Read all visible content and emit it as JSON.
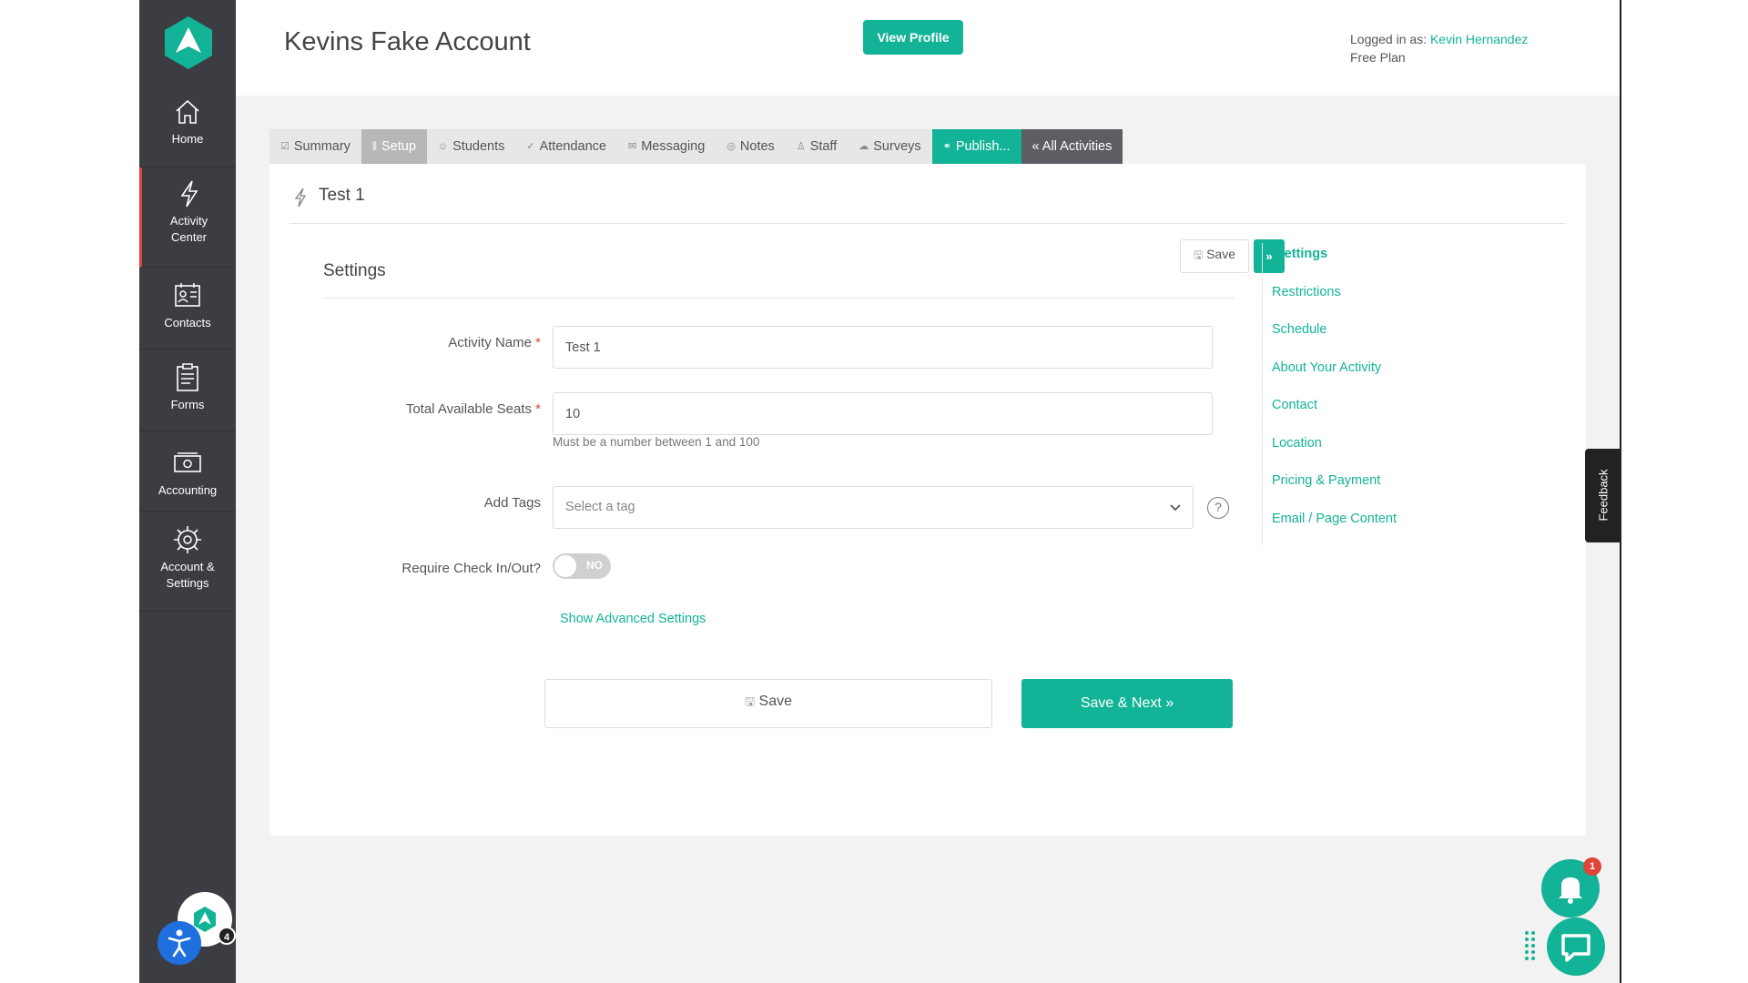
{
  "sidebar": {
    "items": [
      {
        "label": "Home"
      },
      {
        "label": "Activity Center"
      },
      {
        "label": "Contacts"
      },
      {
        "label": "Forms"
      },
      {
        "label": "Accounting"
      },
      {
        "label": "Account & Settings"
      }
    ],
    "avatar_badge": "4"
  },
  "header": {
    "account_title": "Kevins Fake Account",
    "view_profile_label": "View Profile",
    "logged_in_prefix": "Logged in as:",
    "user_name": "Kevin Hernandez",
    "plan": "Free Plan"
  },
  "tabs": [
    {
      "label": "Summary",
      "icon": "checkbox-icon"
    },
    {
      "label": "Setup",
      "icon": "sliders-icon"
    },
    {
      "label": "Students",
      "icon": "face-icon"
    },
    {
      "label": "Attendance",
      "icon": "check-icon"
    },
    {
      "label": "Messaging",
      "icon": "envelope-icon"
    },
    {
      "label": "Notes",
      "icon": "note-icon"
    },
    {
      "label": "Staff",
      "icon": "people-icon"
    },
    {
      "label": "Surveys",
      "icon": "cloud-icon"
    },
    {
      "label": "Publish...",
      "icon": "link-icon"
    },
    {
      "label": "« All Activities"
    }
  ],
  "activity": {
    "title": "Test 1"
  },
  "settings": {
    "title": "Settings",
    "top_save_label": "Save",
    "top_next_label": "»",
    "activity_name_label": "Activity Name",
    "activity_name_value": "Test 1",
    "seats_label": "Total Available Seats",
    "seats_value": "10",
    "seats_help": "Must be a number between 1 and 100",
    "required_mark": "*",
    "tags_label": "Add Tags",
    "tags_placeholder": "Select a tag",
    "help_symbol": "?",
    "checkin_label": "Require Check In/Out?",
    "checkin_toggle_text": "NO",
    "advanced_link": "Show Advanced Settings",
    "save_label": "Save",
    "save_next_label": "Save & Next »"
  },
  "right_nav": [
    {
      "label": "Settings"
    },
    {
      "label": "Restrictions"
    },
    {
      "label": "Schedule"
    },
    {
      "label": "About Your Activity"
    },
    {
      "label": "Contact"
    },
    {
      "label": "Location"
    },
    {
      "label": "Pricing & Payment"
    },
    {
      "label": "Email / Page Content"
    }
  ],
  "feedback_label": "Feedback",
  "notifications_badge": "1",
  "colors": {
    "accent": "#13b397",
    "sidebar": "#3b3d42",
    "alert": "#e0453a"
  }
}
